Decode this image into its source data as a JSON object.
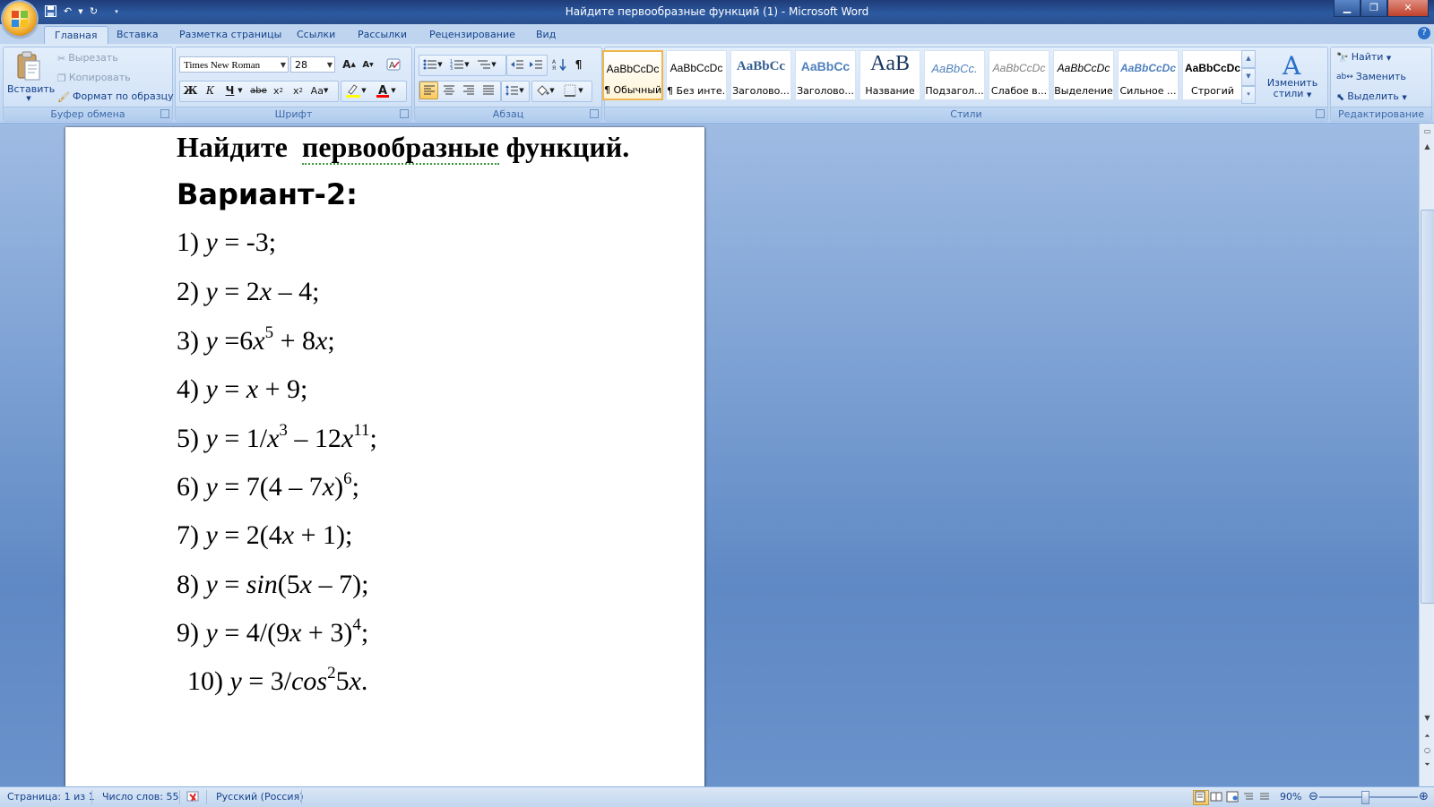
{
  "window": {
    "title": "Найдите  первообразные функций (1) - Microsoft Word"
  },
  "tabs": [
    "Главная",
    "Вставка",
    "Разметка страницы",
    "Ссылки",
    "Рассылки",
    "Рецензирование",
    "Вид"
  ],
  "clipboard": {
    "paste": "Вставить",
    "cut": "Вырезать",
    "copy": "Копировать",
    "format_painter": "Формат по образцу",
    "label": "Буфер обмена"
  },
  "font": {
    "name": "Times New Roman",
    "size": "28",
    "label": "Шрифт"
  },
  "paragraph": {
    "label": "Абзац"
  },
  "styles": {
    "label": "Стили",
    "change_styles": "Изменить стили",
    "items": [
      {
        "sample": "AaBbCcDc",
        "name": "¶ Обычный"
      },
      {
        "sample": "AaBbCcDc",
        "name": "¶ Без инте..."
      },
      {
        "sample": "AaBbCc",
        "name": "Заголово..."
      },
      {
        "sample": "AaBbCc",
        "name": "Заголово..."
      },
      {
        "sample": "AaB",
        "name": "Название"
      },
      {
        "sample": "AaBbCc.",
        "name": "Подзагол..."
      },
      {
        "sample": "AaBbCcDc",
        "name": "Слабое в..."
      },
      {
        "sample": "AaBbCcDc",
        "name": "Выделение"
      },
      {
        "sample": "AaBbCcDc",
        "name": "Сильное ..."
      },
      {
        "sample": "AaBbCcDc",
        "name": "Строгий"
      }
    ]
  },
  "editing": {
    "label": "Редактирование",
    "find": "Найти",
    "replace": "Заменить",
    "select": "Выделить"
  },
  "document": {
    "title_word1": "Найдите",
    "title_word2": "первообразные",
    "title_word3": "функций.",
    "subtitle": "Вариант-2:",
    "lines": {
      "l1": {
        "num": "1)",
        "y": "y",
        "eq": "= -3;"
      },
      "l2": {
        "num": "2)",
        "y": "y",
        "eq": "= 2",
        "x": "x",
        "rest": "– 4;"
      },
      "l3": {
        "num": "3)",
        "y": "y",
        "eq": "=6",
        "x": "x",
        "exp": "5",
        "mid": "+ 8",
        "x2": "x",
        "end": ";"
      },
      "l4": {
        "num": "4)",
        "y": "y",
        "eq": "=",
        "x": "x",
        "rest": "+ 9;"
      },
      "l5": {
        "num": "5)",
        "y": "y",
        "eq": "= 1/",
        "x": "x",
        "exp": "3",
        "mid": "– 12",
        "x2": "x",
        "exp2": "11",
        "end": ";"
      },
      "l6": {
        "num": "6)",
        "y": "y",
        "eq": "= 7(4 – 7",
        "x": "x",
        "close": ")",
        "exp": "6",
        "end": ";"
      },
      "l7": {
        "num": "7)",
        "y": "y",
        "eq": "= 2(4",
        "x": "x",
        "rest": "+ 1);"
      },
      "l8": {
        "num": "8)",
        "y": "y",
        "eq": "=",
        "fn": "sin",
        "open": "(5",
        "x": "x",
        "rest": "– 7);"
      },
      "l9": {
        "num": "9)",
        "y": "y",
        "eq": "= 4/(9",
        "x": "x",
        "close": "+ 3)",
        "exp": "4",
        "end": ";"
      },
      "l10": {
        "num": "10)",
        "y": "y",
        "eq": "= 3/",
        "fn": "cos",
        "exp": "2",
        "mid": "5",
        "x": "x",
        "end": "."
      }
    }
  },
  "status": {
    "page": "Страница: 1 из 1",
    "words": "Число слов: 55",
    "language": "Русский (Россия)",
    "zoom": "90%"
  },
  "colors": {
    "accent_highlight": "#ffff00",
    "font_color": "#ff0000"
  }
}
